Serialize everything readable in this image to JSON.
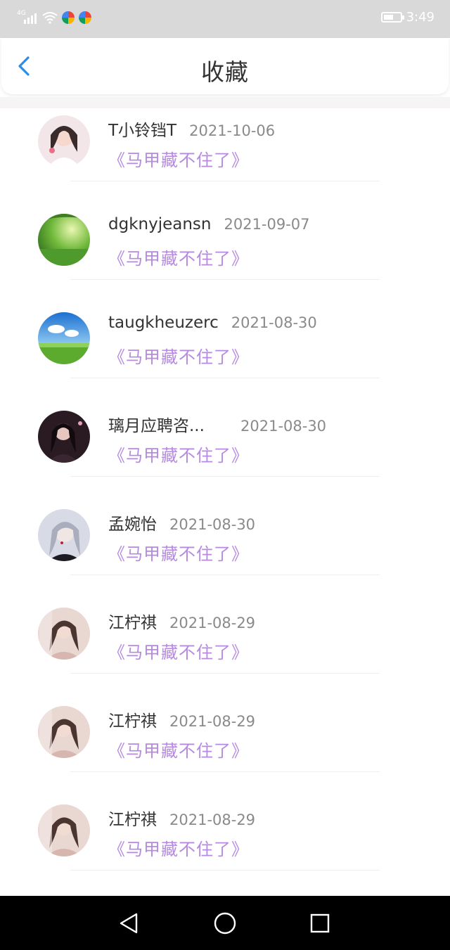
{
  "status_bar": {
    "network": "4G",
    "time": "3:49",
    "battery_level": 0.62
  },
  "header": {
    "title": "收藏"
  },
  "items": [
    {
      "name": "T小铃铛T",
      "date": "2021-10-06",
      "title": "《马甲藏不住了》"
    },
    {
      "name": "dgknyjeansn",
      "date": "2021-09-07",
      "title": "《马甲藏不住了》"
    },
    {
      "name": "taugkheuzerc",
      "date": "2021-08-30",
      "title": "《马甲藏不住了》"
    },
    {
      "name": "璃月应聘咨...",
      "date": "2021-08-30",
      "title": "《马甲藏不住了》"
    },
    {
      "name": "孟婉怡",
      "date": "2021-08-30",
      "title": "《马甲藏不住了》"
    },
    {
      "name": "江柠祺",
      "date": "2021-08-29",
      "title": "《马甲藏不住了》"
    },
    {
      "name": "江柠祺",
      "date": "2021-08-29",
      "title": "《马甲藏不住了》"
    },
    {
      "name": "江柠祺",
      "date": "2021-08-29",
      "title": "《马甲藏不住了》"
    }
  ],
  "colors": {
    "accent_blue": "#2b8de6",
    "title_purple": "#b58ae0",
    "status_bar_bg": "#d9d9d9"
  }
}
